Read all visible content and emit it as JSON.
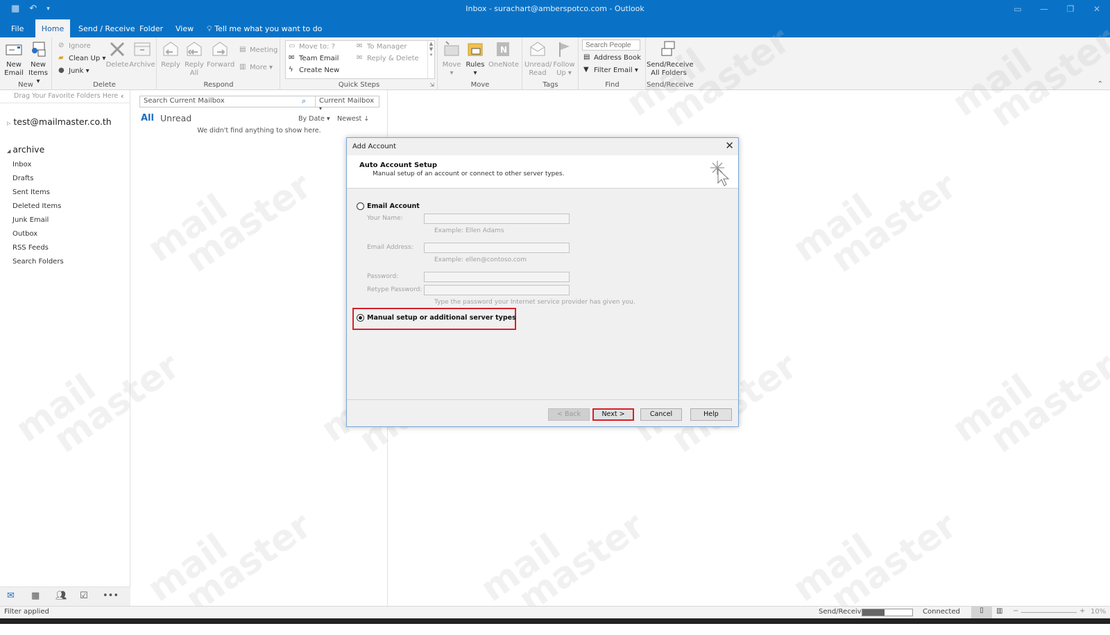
{
  "window": {
    "title": "Inbox - surachart@amberspotco.com  -  Outlook",
    "controls": [
      "ribbon-display-options",
      "minimize",
      "restore",
      "close"
    ]
  },
  "tabs": [
    {
      "label": "File",
      "active": false
    },
    {
      "label": "Home",
      "active": true
    },
    {
      "label": "Send / Receive",
      "active": false
    },
    {
      "label": "Folder",
      "active": false
    },
    {
      "label": "View",
      "active": false
    },
    {
      "label": "Tell me what you want to do",
      "active": false
    }
  ],
  "ribbon": {
    "new": {
      "label": "New",
      "new_email": "New\nEmail",
      "new_email_l1": "New",
      "new_email_l2": "Email",
      "new_items_l1": "New",
      "new_items_l2": "Items ▾"
    },
    "delete": {
      "label": "Delete",
      "ignore": "Ignore",
      "clean_up": "Clean Up ▾",
      "junk": "Junk ▾",
      "delete": "Delete",
      "archive": "Archive"
    },
    "respond": {
      "label": "Respond",
      "reply": "Reply",
      "reply_all_l1": "Reply",
      "reply_all_l2": "All",
      "forward": "Forward",
      "meeting": "Meeting",
      "more": "More ▾"
    },
    "quick_steps": {
      "label": "Quick Steps",
      "items": [
        "Move to: ?",
        "Team Email",
        "Create New",
        "To Manager",
        "Reply & Delete"
      ]
    },
    "move": {
      "label": "Move",
      "move": "Move",
      "rules": "Rules",
      "onenote": "OneNote"
    },
    "tags": {
      "label": "Tags",
      "unread_l1": "Unread/",
      "unread_l2": "Read",
      "follow_l1": "Follow",
      "follow_l2": "Up ▾"
    },
    "find": {
      "label": "Find",
      "search_people_placeholder": "Search People",
      "address_book": "Address Book",
      "filter_email": "Filter Email ▾"
    },
    "send_receive": {
      "label": "Send/Receive",
      "btn_l1": "Send/Receive",
      "btn_l2": "All Folders"
    }
  },
  "folder_pane": {
    "favorites_hint": "Drag Your Favorite Folders Here",
    "account": "test@mailmaster.co.th",
    "archive_label": "archive",
    "folders": [
      "Inbox",
      "Drafts",
      "Sent Items",
      "Deleted Items",
      "Junk Email",
      "Outbox",
      "RSS Feeds",
      "Search Folders"
    ]
  },
  "message_list": {
    "search_placeholder": "Search Current Mailbox",
    "scope": "Current Mailbox",
    "filter_all": "All",
    "filter_unread": "Unread",
    "sort_by": "By Date ▾",
    "order": "Newest ↓",
    "empty_text": "We didn't find anything to show here."
  },
  "dialog": {
    "title": "Add Account",
    "header_title": "Auto Account Setup",
    "header_subtitle": "Manual setup of an account or connect to other server types.",
    "option_email": {
      "label": "Email Account",
      "selected": false
    },
    "fields": [
      {
        "label": "Your Name:",
        "value": "",
        "hint": "Example: Ellen Adams"
      },
      {
        "label": "Email Address:",
        "value": "",
        "hint": "Example: ellen@contoso.com"
      },
      {
        "label": "Password:",
        "value": ""
      },
      {
        "label": "Retype Password:",
        "value": "",
        "hint": "Type the password your Internet service provider has given you."
      }
    ],
    "option_manual": {
      "label": "Manual setup or additional server types",
      "selected": true
    },
    "buttons": {
      "back": "< Back",
      "next": "Next >",
      "cancel": "Cancel",
      "help": "Help"
    },
    "highlight_color": "#d8202a"
  },
  "nav": [
    "mail",
    "calendar",
    "people",
    "tasks",
    "more"
  ],
  "status": {
    "left": "Filter applied",
    "send_receive_label": "Send/Receive",
    "send_receive_progress": 0.45,
    "connection": "Connected",
    "zoom": "10%"
  },
  "watermark": "mail master",
  "colors": {
    "accent": "#0a72c6",
    "highlight": "#d8202a"
  }
}
